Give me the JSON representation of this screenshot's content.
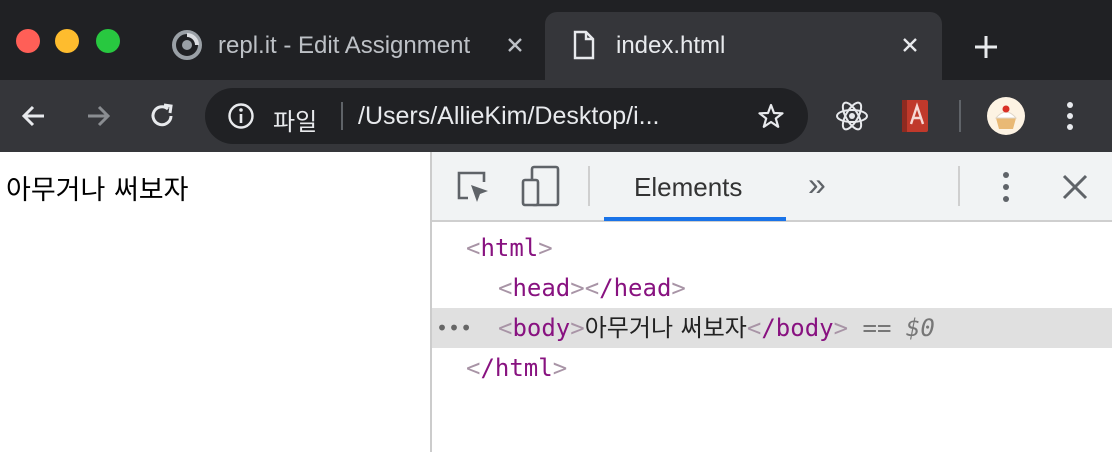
{
  "tabs": [
    {
      "title": "repl.it - Edit Assignment",
      "icon": "replit-icon",
      "active": false
    },
    {
      "title": "index.html",
      "icon": "file-icon",
      "active": true
    }
  ],
  "address_bar": {
    "label": "파일",
    "url": "/Users/AllieKim/Desktop/i..."
  },
  "page": {
    "text": "아무거나 써보자"
  },
  "devtools": {
    "tab_label": "Elements",
    "more_tabs": "»",
    "dom": {
      "html_open_tag": "html",
      "head_open_tag": "head",
      "head_close_tag": "/head",
      "body_open_tag": "body",
      "body_text": "아무거나 써보자",
      "body_close_tag": "/body",
      "selected_marker": "== $0",
      "html_close_tag": "/html",
      "dots": "•••"
    }
  },
  "colors": {
    "tab_strip": "#202124",
    "toolbar": "#35363a",
    "tag": "#881280",
    "selection": "#e0e0e0",
    "underline": "#1a73e8"
  }
}
